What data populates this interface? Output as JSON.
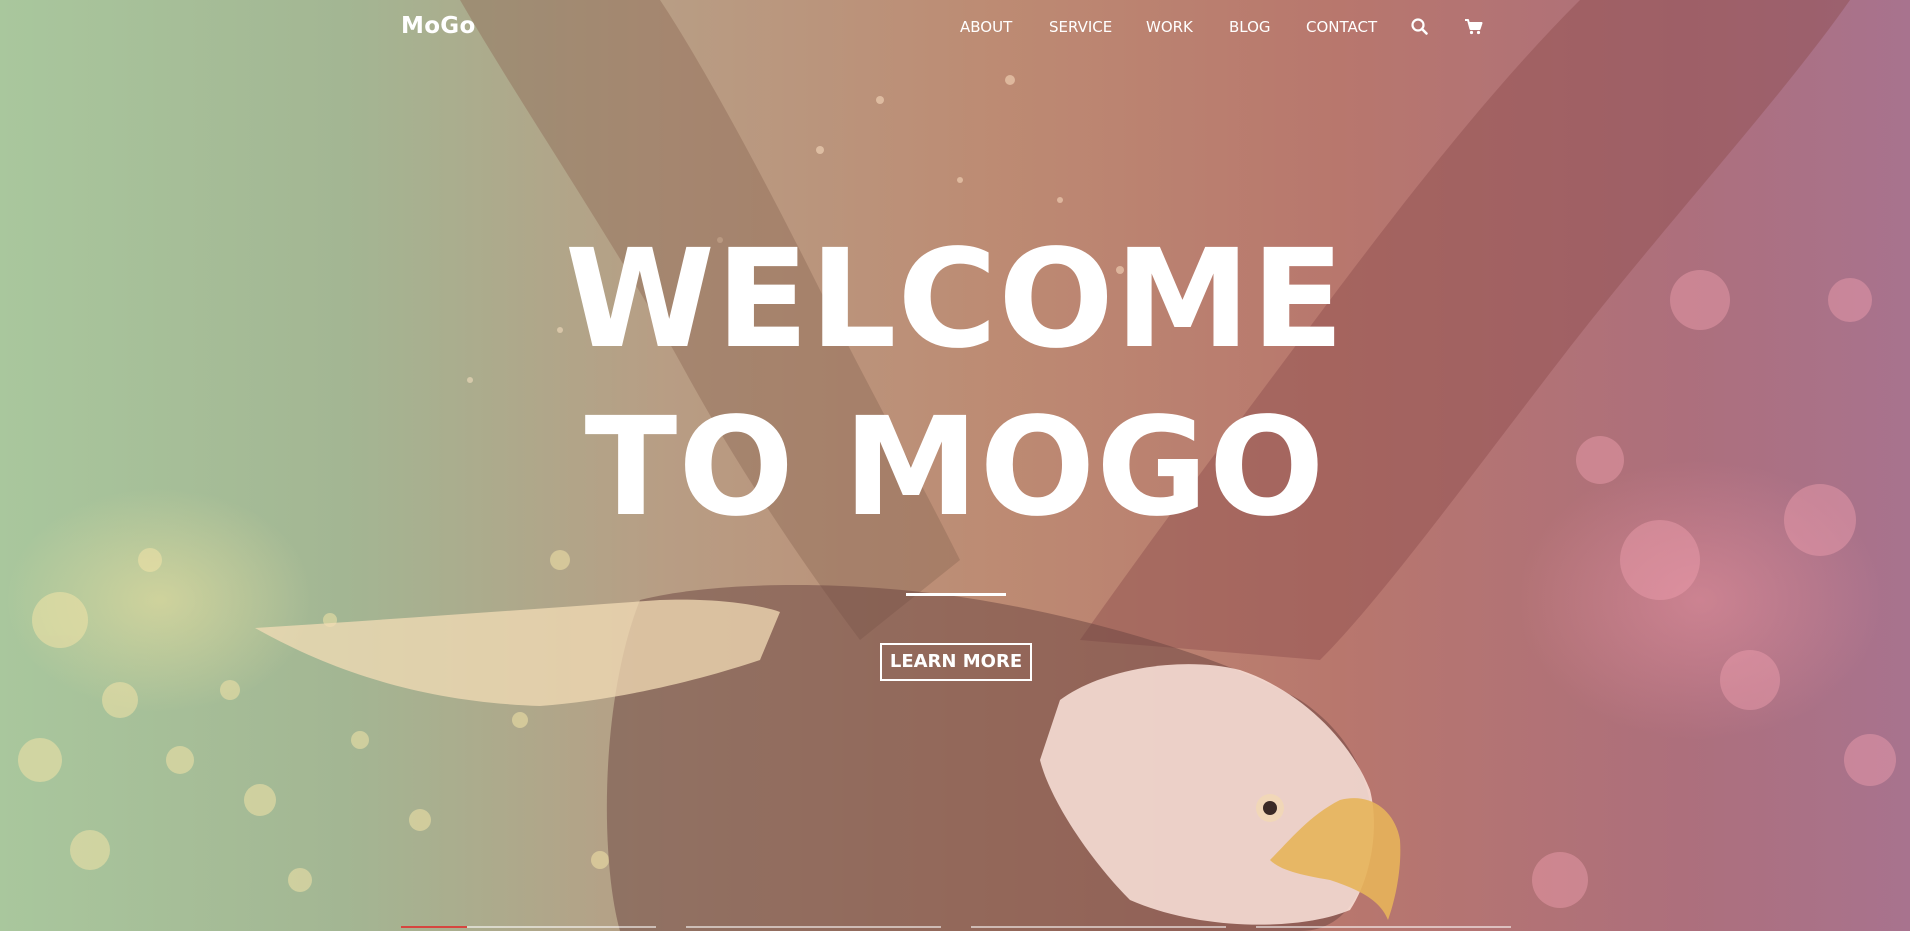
{
  "brand": {
    "logo_text": "MoGo"
  },
  "nav": {
    "items": [
      {
        "label": "ABOUT"
      },
      {
        "label": "SERVICE"
      },
      {
        "label": "WORK"
      },
      {
        "label": "BLOG"
      },
      {
        "label": "CONTACT"
      }
    ],
    "icons": [
      "search-icon",
      "cart-icon"
    ]
  },
  "hero": {
    "title_line1": "WELCOME",
    "title_line2": "TO MOGO",
    "button_label": "LEARN MORE"
  },
  "slider": {
    "slides": 4,
    "active_index": 0,
    "active_progress": 0.26
  },
  "colors": {
    "text": "#ffffff",
    "accent": "#d6453f"
  }
}
